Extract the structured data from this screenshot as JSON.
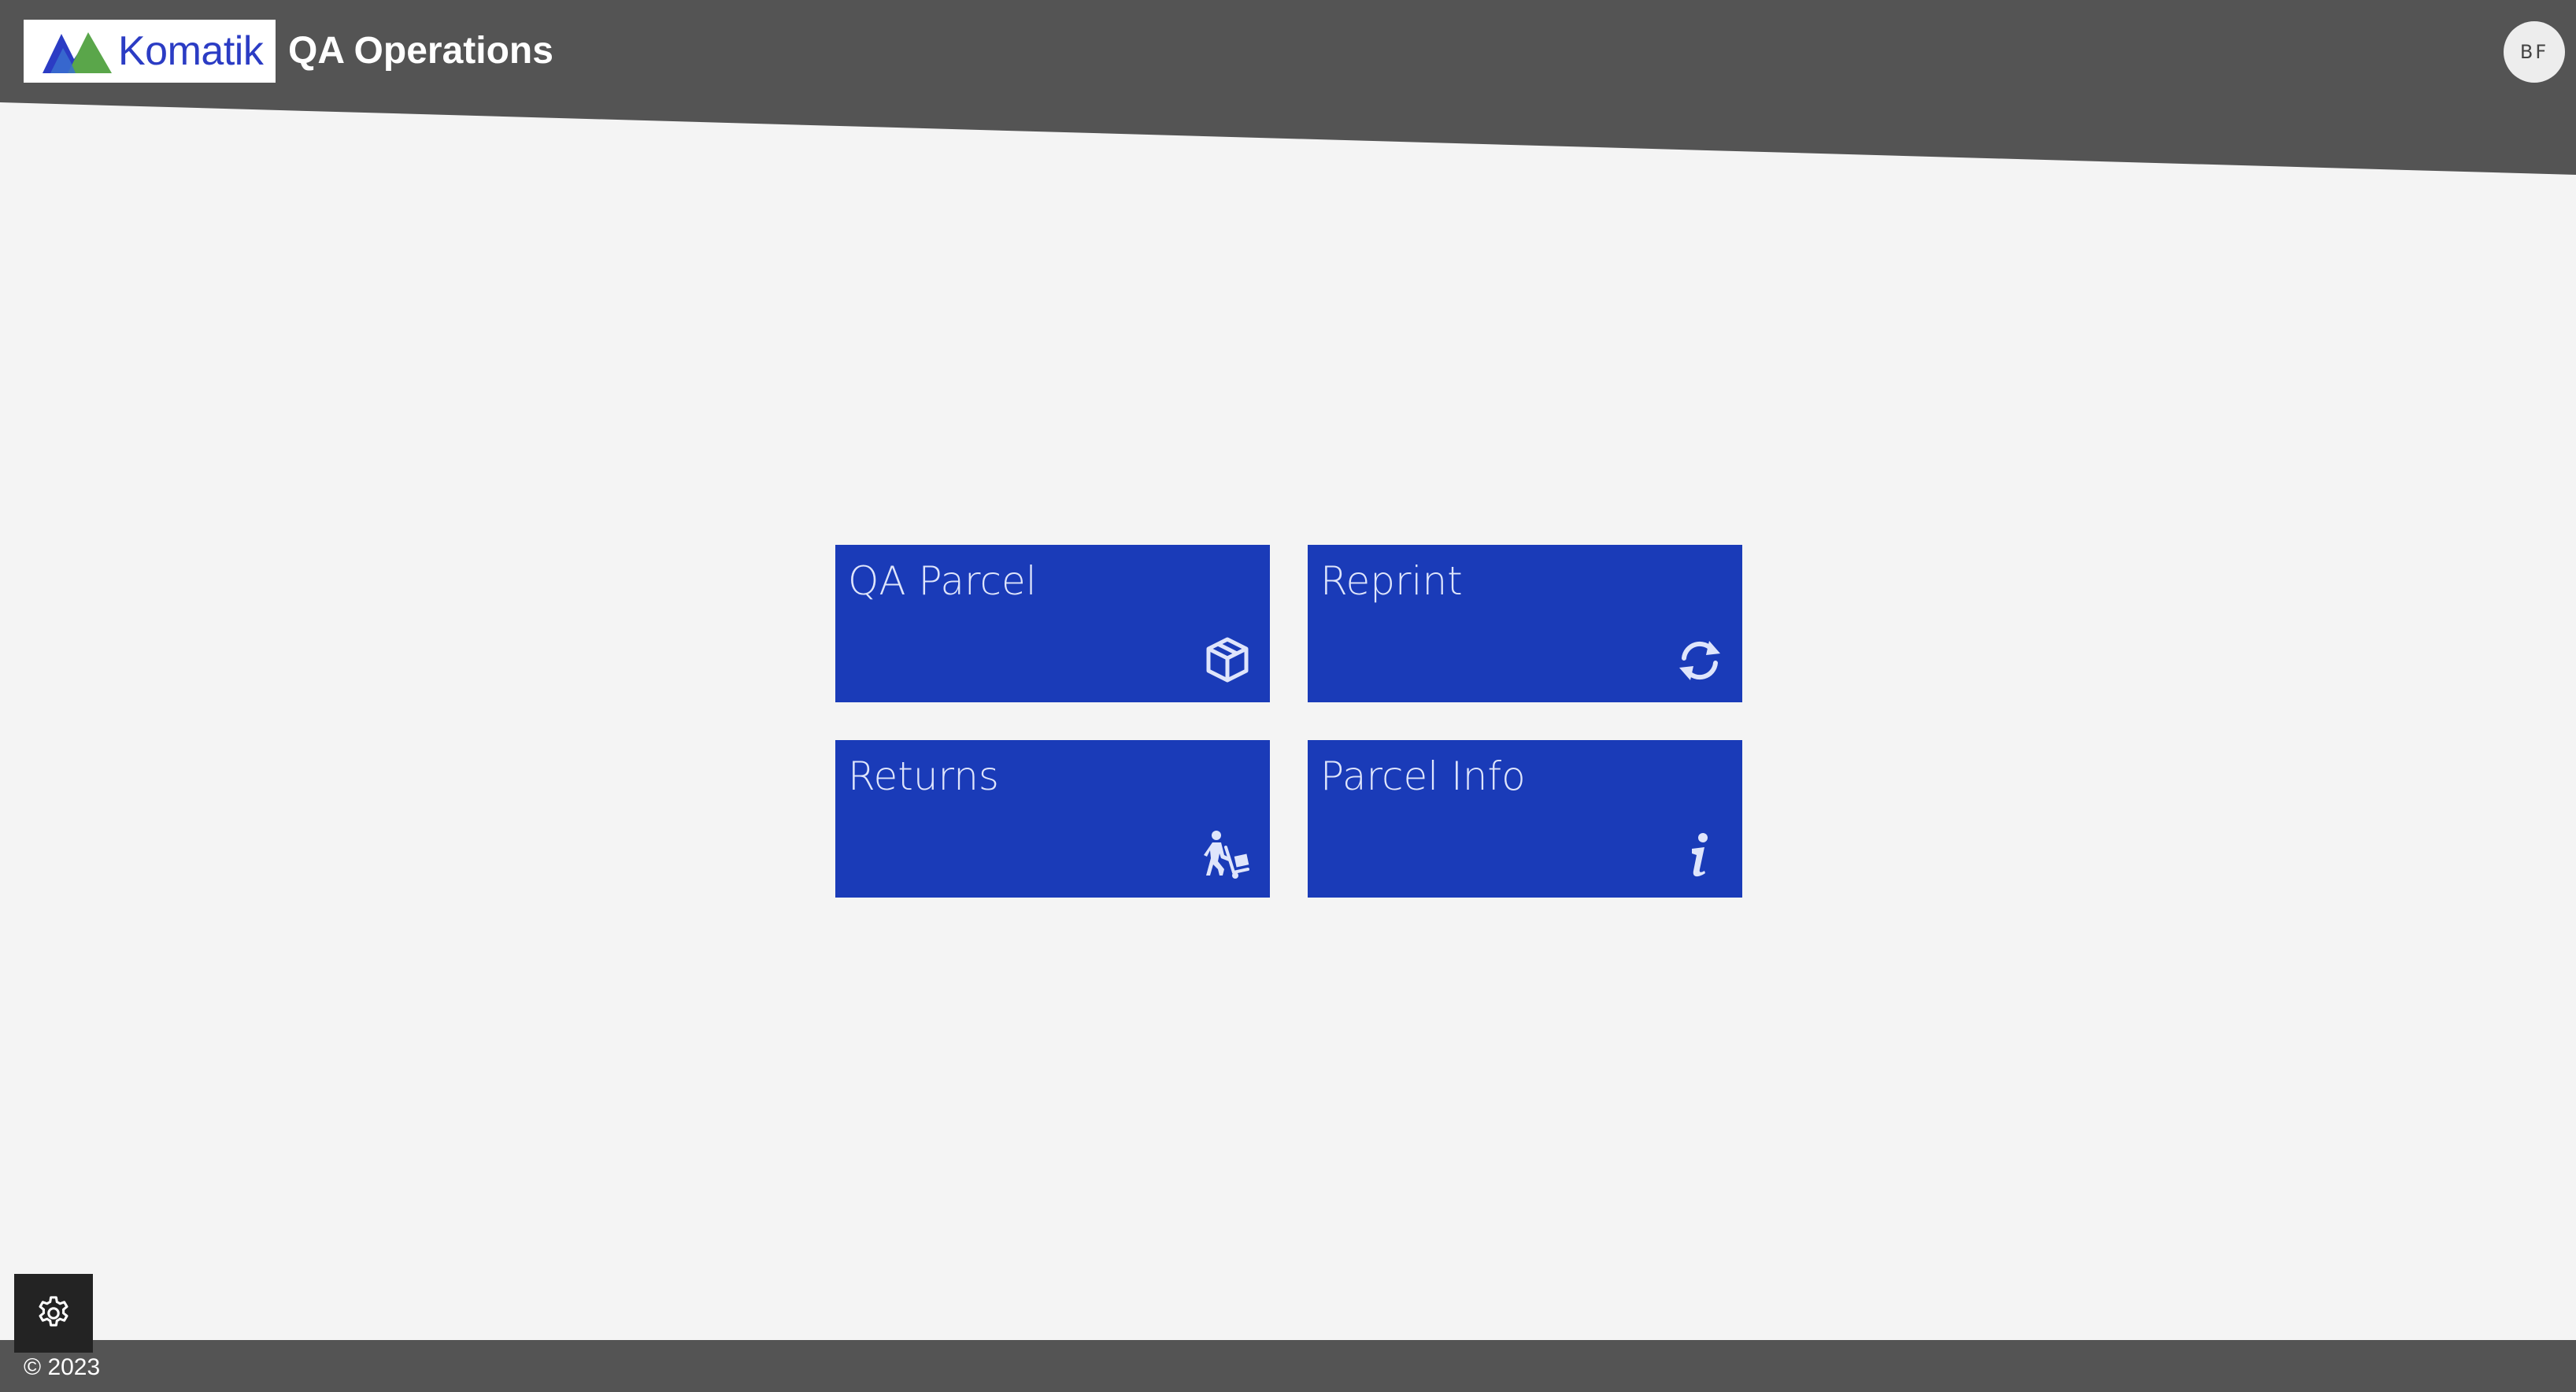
{
  "header": {
    "brand_name": "Komatik",
    "app_title": "QA Operations",
    "user_initials": "BF",
    "background_color": "#545454"
  },
  "tiles": [
    {
      "label": "QA Parcel",
      "icon": "box-icon"
    },
    {
      "label": "Reprint",
      "icon": "sync-icon"
    },
    {
      "label": "Returns",
      "icon": "person-dolly-icon"
    },
    {
      "label": "Parcel Info",
      "icon": "info-icon"
    }
  ],
  "footer": {
    "copyright": "© 2023",
    "settings_icon": "gear-icon"
  },
  "colors": {
    "tile_background": "#1a3bb8",
    "tile_text": "#dfe5fb",
    "page_background": "#f4f4f4",
    "brand_blue": "#2b3cc4",
    "brand_green": "#5aa64a"
  }
}
